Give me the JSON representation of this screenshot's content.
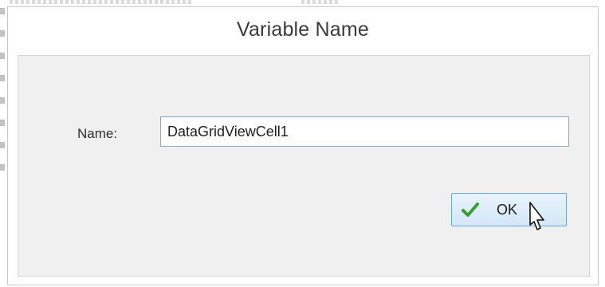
{
  "dialog": {
    "title": "Variable Name",
    "name_label": "Name:",
    "name_value": "DataGridViewCell1",
    "ok_label": "OK"
  },
  "icons": {
    "ok_icon": "green-check-icon",
    "pointer": "mouse-pointer-icon"
  },
  "colors": {
    "check": "#3aa02c",
    "button_border": "#6fa6d6",
    "input_border": "#8aa9cf",
    "client_background": "#f0f0f0"
  }
}
